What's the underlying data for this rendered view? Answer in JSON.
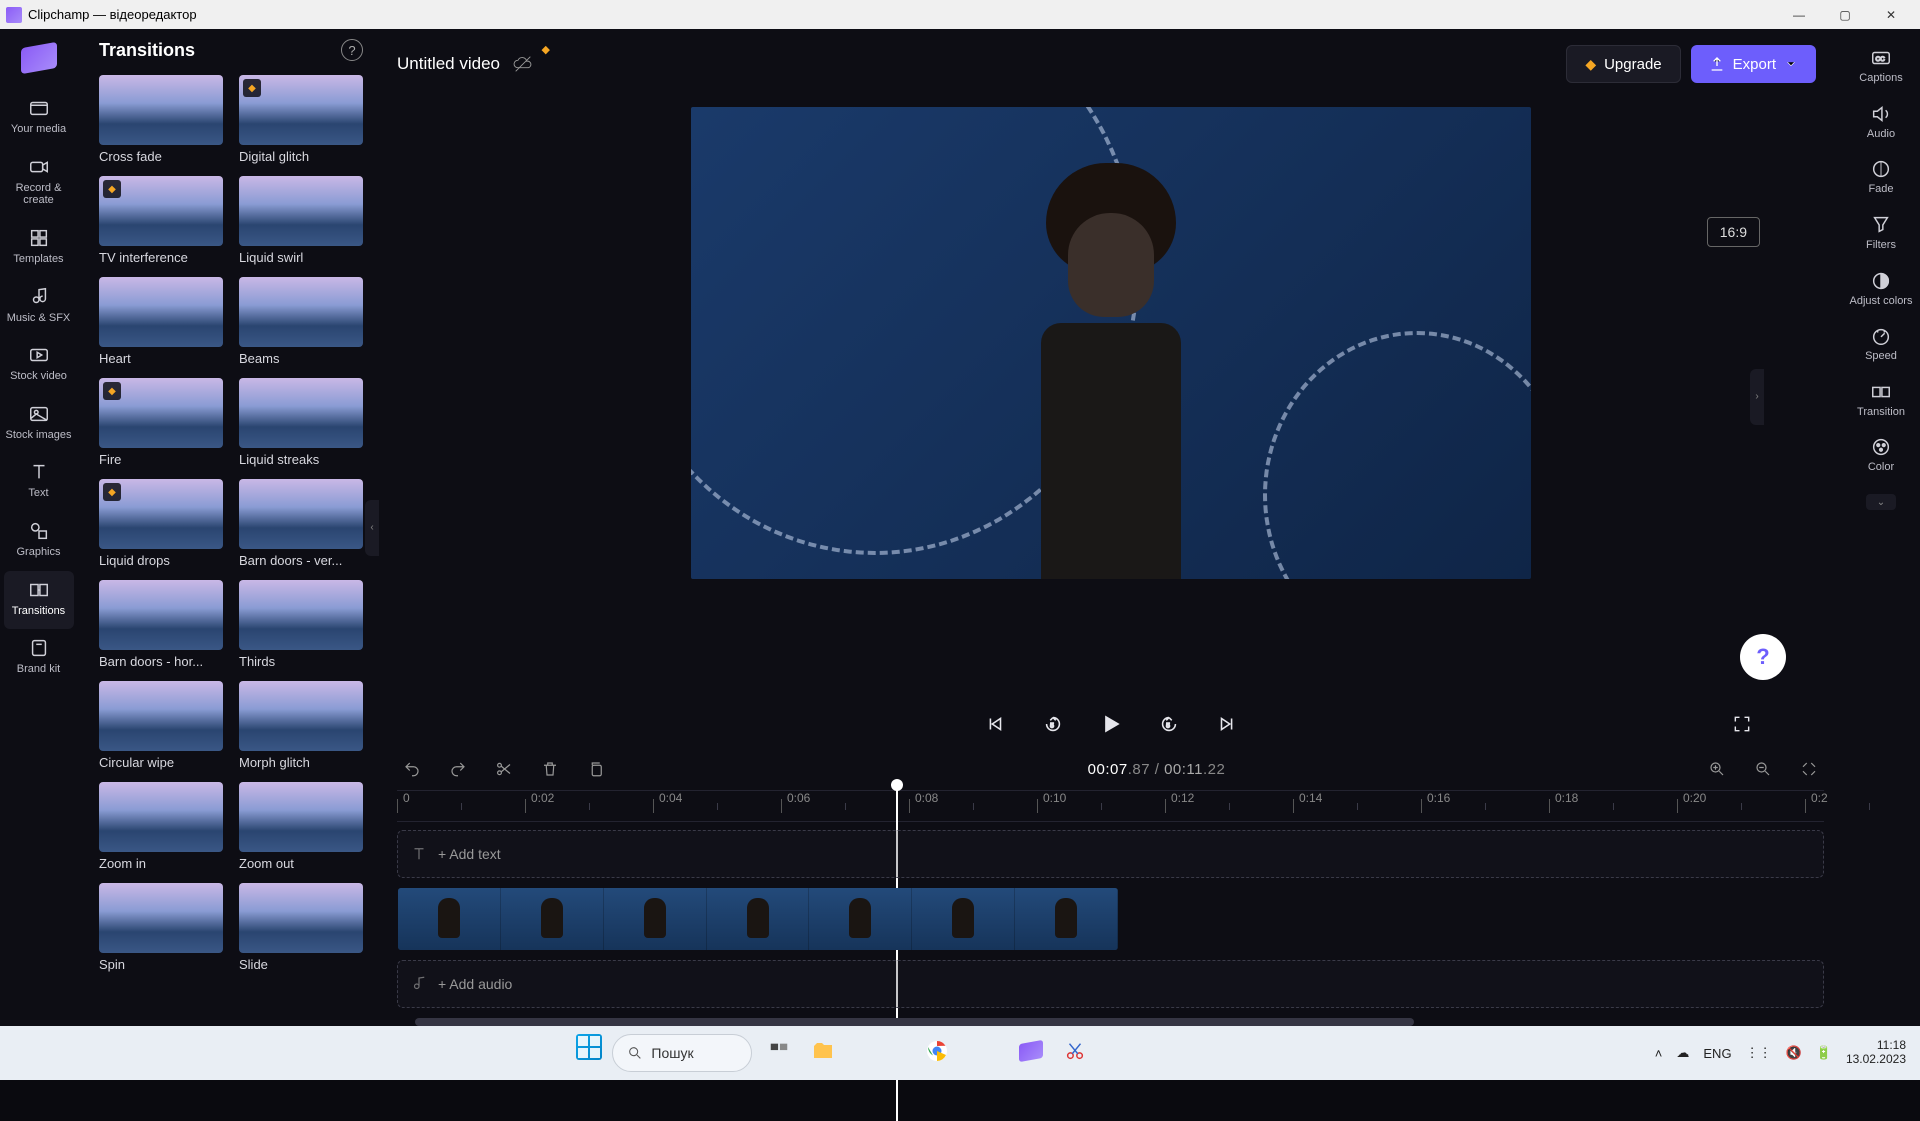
{
  "window_title": "Clipchamp — відеоредактор",
  "rail": [
    {
      "id": "your-media",
      "label": "Your media",
      "icon": "folder"
    },
    {
      "id": "record",
      "label": "Record & create",
      "icon": "camera"
    },
    {
      "id": "templates",
      "label": "Templates",
      "icon": "grid"
    },
    {
      "id": "music",
      "label": "Music & SFX",
      "icon": "music"
    },
    {
      "id": "stock-video",
      "label": "Stock video",
      "icon": "video"
    },
    {
      "id": "stock-images",
      "label": "Stock images",
      "icon": "image"
    },
    {
      "id": "text",
      "label": "Text",
      "icon": "text"
    },
    {
      "id": "graphics",
      "label": "Graphics",
      "icon": "shapes"
    },
    {
      "id": "transitions",
      "label": "Transitions",
      "icon": "transition",
      "active": true
    },
    {
      "id": "brandkit",
      "label": "Brand kit",
      "icon": "brand"
    }
  ],
  "panel": {
    "title": "Transitions",
    "items": [
      {
        "label": "Cross fade",
        "premium": false
      },
      {
        "label": "Digital glitch",
        "premium": true
      },
      {
        "label": "TV interference",
        "premium": true
      },
      {
        "label": "Liquid swirl",
        "premium": false
      },
      {
        "label": "Heart",
        "premium": false
      },
      {
        "label": "Beams",
        "premium": false
      },
      {
        "label": "Fire",
        "premium": true
      },
      {
        "label": "Liquid streaks",
        "premium": false
      },
      {
        "label": "Liquid drops",
        "premium": true
      },
      {
        "label": "Barn doors - ver...",
        "premium": false
      },
      {
        "label": "Barn doors - hor...",
        "premium": false
      },
      {
        "label": "Thirds",
        "premium": false
      },
      {
        "label": "Circular wipe",
        "premium": false
      },
      {
        "label": "Morph glitch",
        "premium": false
      },
      {
        "label": "Zoom in",
        "premium": false
      },
      {
        "label": "Zoom out",
        "premium": false
      },
      {
        "label": "Spin",
        "premium": false
      },
      {
        "label": "Slide",
        "premium": false
      }
    ]
  },
  "project_title": "Untitled video",
  "upgrade_label": "Upgrade",
  "export_label": "Export",
  "aspect_ratio": "16:9",
  "timecode": {
    "current": "00:07",
    "current_ms": ".87",
    "sep": " / ",
    "total": "00:11",
    "total_ms": ".22"
  },
  "ruler_ticks": [
    "0",
    "0:02",
    "0:04",
    "0:06",
    "0:08",
    "0:10",
    "0:12",
    "0:14",
    "0:16",
    "0:18",
    "0:20",
    "0:2"
  ],
  "playhead_index": 3.9,
  "tracks": {
    "text_placeholder": "+  Add text",
    "audio_placeholder": "+  Add audio"
  },
  "prail": [
    {
      "id": "captions",
      "label": "Captions"
    },
    {
      "id": "audio",
      "label": "Audio"
    },
    {
      "id": "fade",
      "label": "Fade"
    },
    {
      "id": "filters",
      "label": "Filters"
    },
    {
      "id": "adjust",
      "label": "Adjust colors"
    },
    {
      "id": "speed",
      "label": "Speed"
    },
    {
      "id": "transition",
      "label": "Transition"
    },
    {
      "id": "color",
      "label": "Color"
    }
  ],
  "taskbar": {
    "search": "Пошук",
    "lang": "ENG",
    "time": "11:18",
    "date": "13.02.2023"
  }
}
